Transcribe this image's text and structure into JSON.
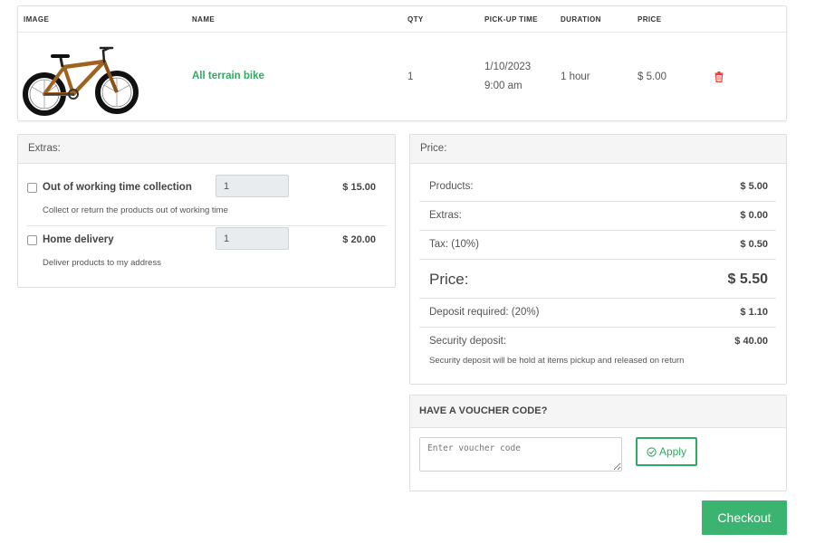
{
  "cart": {
    "headers": {
      "image": "IMAGE",
      "name": "NAME",
      "qty": "QTY",
      "pickup": "PICK-UP TIME",
      "duration": "DURATION",
      "price": "PRICE"
    },
    "row": {
      "image": "bike-image",
      "name": "All terrain bike",
      "qty": "1",
      "pickup_date": "1/10/2023",
      "pickup_time": "9:00 am",
      "duration": "1 hour",
      "price": "$ 5.00",
      "delete_icon": "trash-icon"
    }
  },
  "extras": {
    "title": "Extras:",
    "items": [
      {
        "label": "Out of working time collection",
        "desc": "Collect or return the products out of working time",
        "qty": "1",
        "price": "$ 15.00",
        "checked": false
      },
      {
        "label": "Home delivery",
        "desc": "Deliver products to my address",
        "qty": "1",
        "price": "$ 20.00",
        "checked": false
      }
    ]
  },
  "price": {
    "title": "Price:",
    "products_label": "Products:",
    "products_value": "$ 5.00",
    "extras_label": "Extras:",
    "extras_value": "$ 0.00",
    "tax_label": "Tax: (10%)",
    "tax_value": "$ 0.50",
    "total_label": "Price:",
    "total_value": "$ 5.50",
    "deposit_label": "Deposit required: (20%)",
    "deposit_value": "$ 1.10",
    "security_label": "Security deposit:",
    "security_value": "$ 40.00",
    "security_note": "Security deposit will be hold at items pickup and released on return"
  },
  "voucher": {
    "title": "HAVE A VOUCHER CODE?",
    "placeholder": "Enter voucher code",
    "apply_label": "Apply",
    "apply_icon": "check-circle-icon"
  },
  "checkout_label": "Checkout",
  "colors": {
    "accent": "#3bb371",
    "link": "#2faa62",
    "danger": "#e53935"
  }
}
